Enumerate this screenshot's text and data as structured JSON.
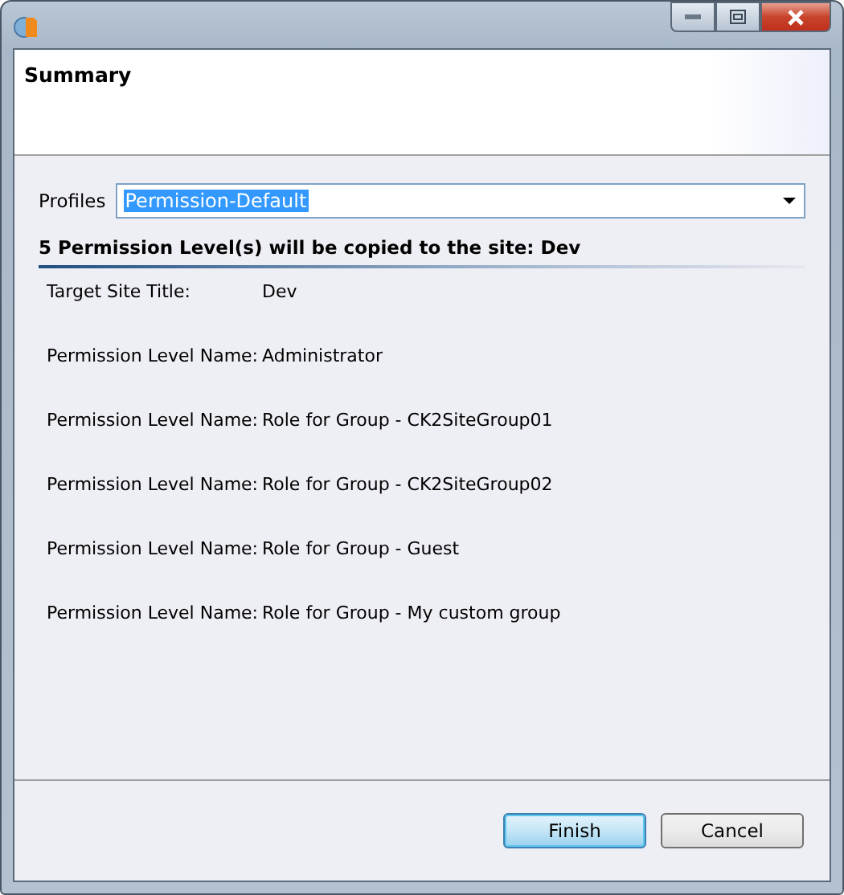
{
  "header": {
    "title": "Summary"
  },
  "profiles": {
    "label": "Profiles",
    "value": "Permission-Default"
  },
  "section": {
    "title": "5 Permission Level(s) will be copied to the site: Dev"
  },
  "rows": [
    {
      "label": "Target Site Title:",
      "value": "Dev"
    },
    {
      "label": "Permission Level Name:",
      "value": "Administrator"
    },
    {
      "label": "Permission Level Name:",
      "value": "Role for Group - CK2SiteGroup01"
    },
    {
      "label": "Permission Level Name:",
      "value": "Role for Group - CK2SiteGroup02"
    },
    {
      "label": "Permission Level Name:",
      "value": "Role for Group - Guest"
    },
    {
      "label": "Permission Level Name:",
      "value": "Role for Group - My custom group"
    }
  ],
  "buttons": [
    {
      "label": "Finish",
      "selected": true
    },
    {
      "label": "Cancel",
      "selected": false
    }
  ]
}
